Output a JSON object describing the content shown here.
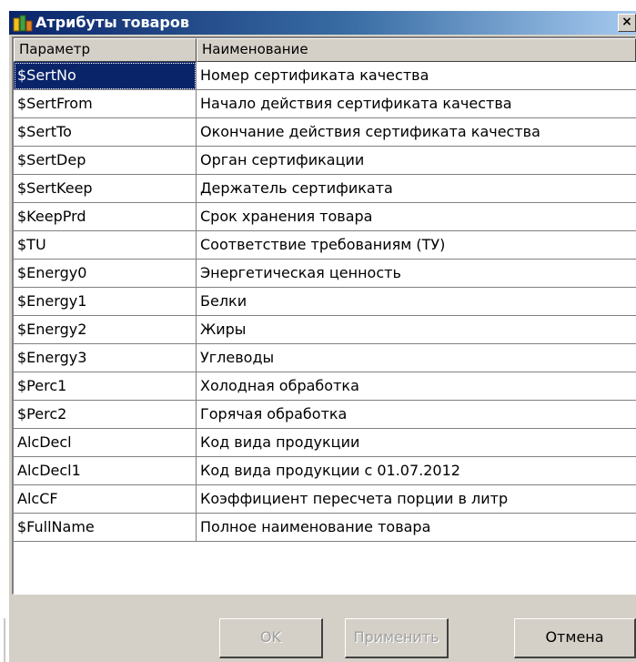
{
  "window": {
    "title": "Атрибуты товаров",
    "close_glyph": "×"
  },
  "table": {
    "columns": [
      "Параметр",
      "Наименование"
    ],
    "rows": [
      {
        "param": "$SertNo",
        "name": "Номер сертификата качества",
        "selected": true
      },
      {
        "param": "$SertFrom",
        "name": "Начало действия сертификата качества"
      },
      {
        "param": "$SertTo",
        "name": "Окончание действия сертификата качества"
      },
      {
        "param": "$SertDep",
        "name": "Орган сертификации"
      },
      {
        "param": "$SertKeep",
        "name": "Держатель сертификата"
      },
      {
        "param": "$KeepPrd",
        "name": "Срок хранения товара"
      },
      {
        "param": "$TU",
        "name": "Соответствие требованиям (ТУ)"
      },
      {
        "param": "$Energy0",
        "name": "Энергетическая ценность"
      },
      {
        "param": "$Energy1",
        "name": "Белки"
      },
      {
        "param": "$Energy2",
        "name": "Жиры"
      },
      {
        "param": "$Energy3",
        "name": "Углеводы"
      },
      {
        "param": "$Perc1",
        "name": "Холодная обработка"
      },
      {
        "param": "$Perc2",
        "name": "Горячая обработка"
      },
      {
        "param": "AlcDecl",
        "name": "Код вида продукции"
      },
      {
        "param": "AlcDecl1",
        "name": "Код вида продукции с 01.07.2012"
      },
      {
        "param": "AlcCF",
        "name": "Коэффициент пересчета порции в литр"
      },
      {
        "param": "$FullName",
        "name": "Полное наименование товара"
      }
    ]
  },
  "buttons": {
    "ok": "OK",
    "apply": "Применить",
    "cancel": "Отмена"
  },
  "colors": {
    "title_bar": "#0a246a",
    "selection": "#0a246a",
    "face": "#d4d0c8"
  }
}
